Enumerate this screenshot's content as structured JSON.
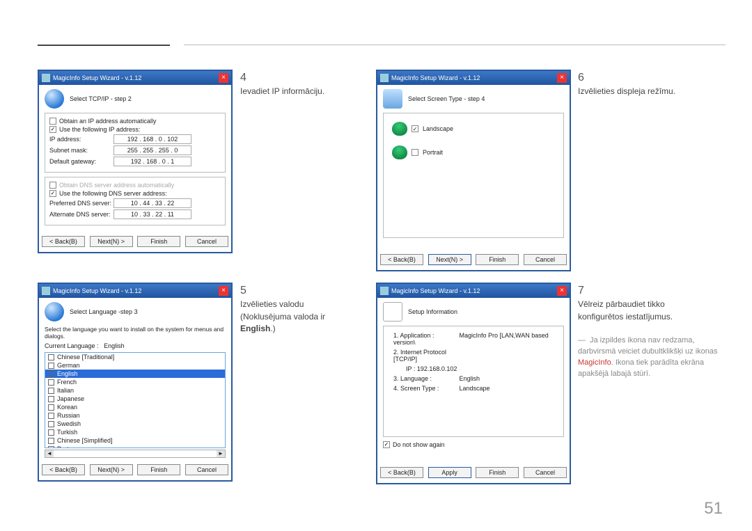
{
  "page_number": "51",
  "wizard_title": "MagicInfo Setup Wizard  - v.1.12",
  "buttons": {
    "back": "< Back(B)",
    "next": "Next(N) >",
    "finish": "Finish",
    "cancel": "Cancel",
    "apply": "Apply"
  },
  "step4": {
    "num": "4",
    "text": "Ievadiet IP informāciju.",
    "heading": "Select TCP/IP - step 2",
    "obtain_auto": "Obtain an IP address automatically",
    "use_following": "Use the following IP address:",
    "ip_label": "IP address:",
    "ip_value": "192 . 168 .   0  . 102",
    "subnet_label": "Subnet mask:",
    "subnet_value": "255 . 255 . 255 .   0",
    "gw_label": "Default gateway:",
    "gw_value": "192 . 168 .   0  .    1",
    "dns_auto": "Obtain DNS server address automatically",
    "dns_use": "Use the following DNS server address:",
    "pref_label": "Preferred DNS server:",
    "pref_value": "10 . 44 . 33 . 22",
    "alt_label": "Alternate DNS server:",
    "alt_value": "10 . 33 . 22 . 11"
  },
  "step5": {
    "num": "5",
    "text_a": "Izvēlieties valodu (Noklusējuma valoda ir ",
    "text_b": "English",
    "text_c": ".)",
    "heading": "Select Language -step 3",
    "desc": "Select the language you want to install on the system for menus and dialogs.",
    "current_lbl": "Current Language     :",
    "current_val": "English",
    "langs": [
      "Chinese [Traditional]",
      "German",
      "English",
      "French",
      "Italian",
      "Japanese",
      "Korean",
      "Russian",
      "Swedish",
      "Turkish",
      "Chinese [Simplified]",
      "Portuguese"
    ],
    "selected_index": 2
  },
  "step6": {
    "num": "6",
    "text": "Izvēlieties displeja režīmu.",
    "heading": "Select Screen Type - step 4",
    "opt_landscape": "Landscape",
    "opt_portrait": "Portrait"
  },
  "step7": {
    "num": "7",
    "text": "Vēlreiz pārbaudiet tikko konfigurētos iestatījumus.",
    "heading": "Setup Information",
    "rows": [
      {
        "k": "1. Application  :",
        "v": "MagicInfo Pro [LAN,WAN based version\\"
      },
      {
        "k": "2. Internet Protocol [TCP/IP]",
        "v": ""
      },
      {
        "k": "IP  :",
        "v": "192.168.0.102",
        "indent": true
      },
      {
        "k": "3. Language  :",
        "v": "English"
      },
      {
        "k": "4. Screen Type  :",
        "v": "Landscape"
      }
    ],
    "donotshow": "Do not show again"
  },
  "note": {
    "pre": "Ja izpildes ikona nav redzama, darbvirsmā veiciet dubultklikšķi uz ikonas ",
    "mi": "MagicInfo",
    "post": ". Ikona tiek parādīta ekrāna apakšējā labajā stūrī."
  }
}
